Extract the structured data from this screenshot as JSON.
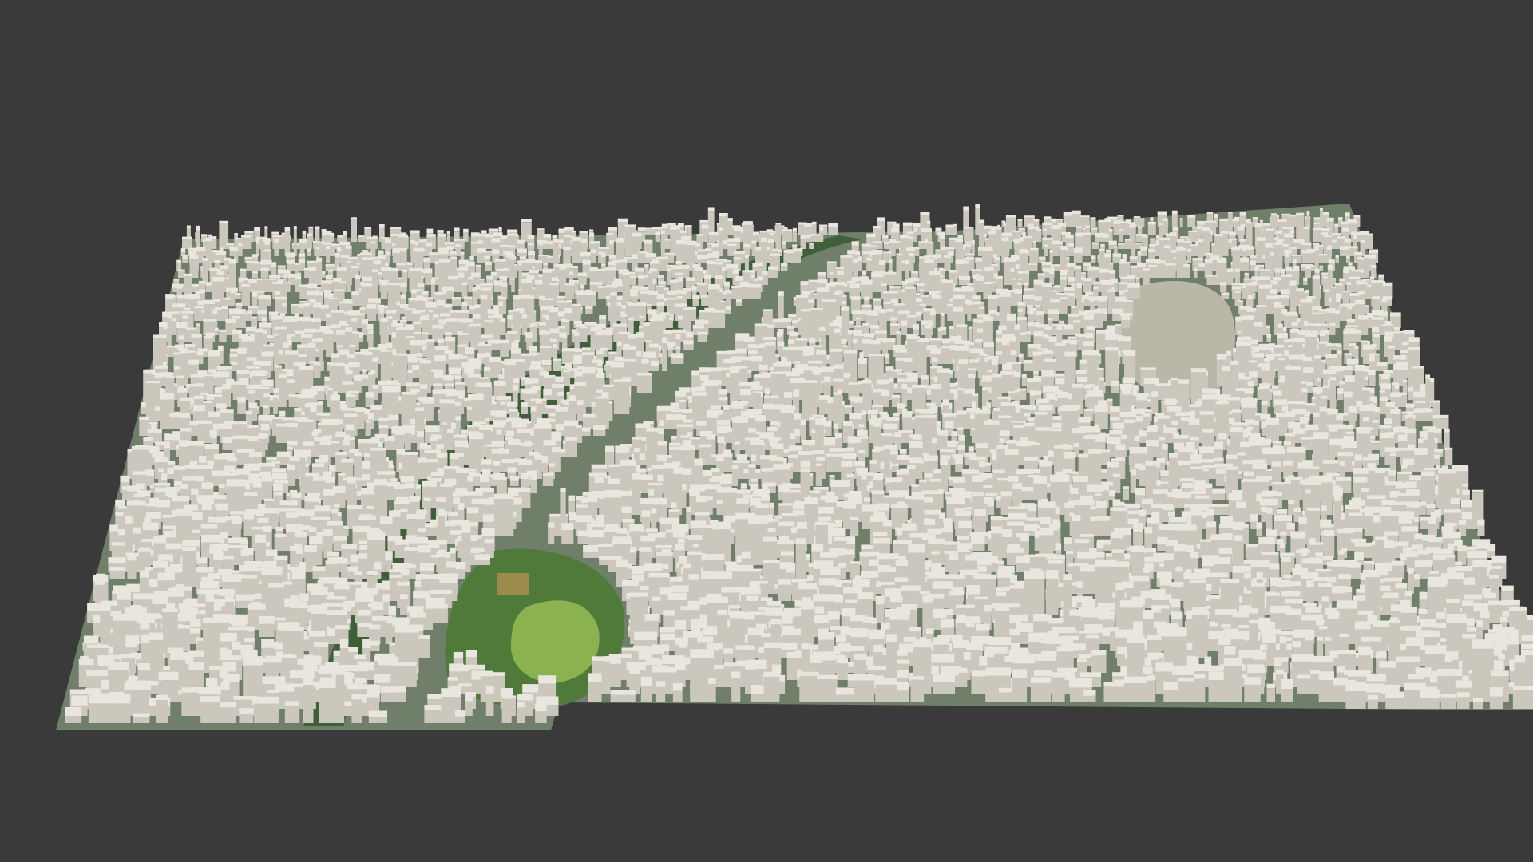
{
  "scene": {
    "kind": "3D city model viewport",
    "background_color": "#3a3a3a",
    "building_color": "#e9e6df",
    "building_side_color": "#cbc7bc",
    "ground_color": "#6f7f6a",
    "park_color": "#4f7a3a",
    "lawn_color": "#8ab34f",
    "river_color": "#3f5f3a",
    "plaza_color": "#b9b8a8"
  }
}
